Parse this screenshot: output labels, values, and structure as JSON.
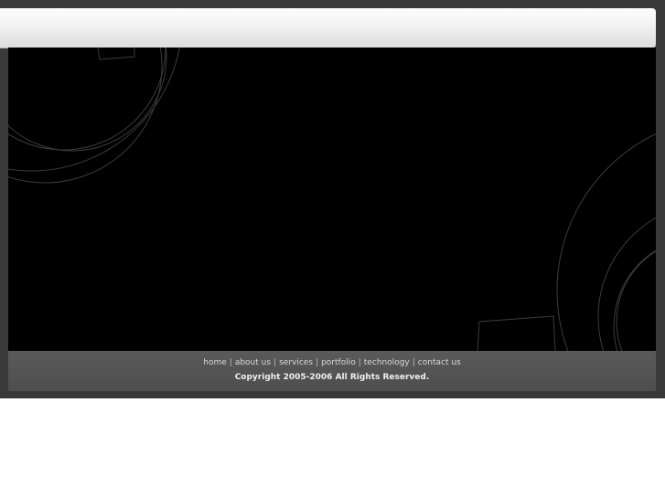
{
  "footer": {
    "nav": [
      {
        "label": "home"
      },
      {
        "label": "about us"
      },
      {
        "label": "services"
      },
      {
        "label": "portfolio"
      },
      {
        "label": "technology"
      },
      {
        "label": "contact us"
      }
    ],
    "separator": "|",
    "copyright": "Copyright 2005-2006 All Rights Reserved."
  },
  "colors": {
    "frame": "#3a3a3a",
    "stage": "#000000",
    "footer": "#555555",
    "decor_lines": "#3c3c3c"
  }
}
